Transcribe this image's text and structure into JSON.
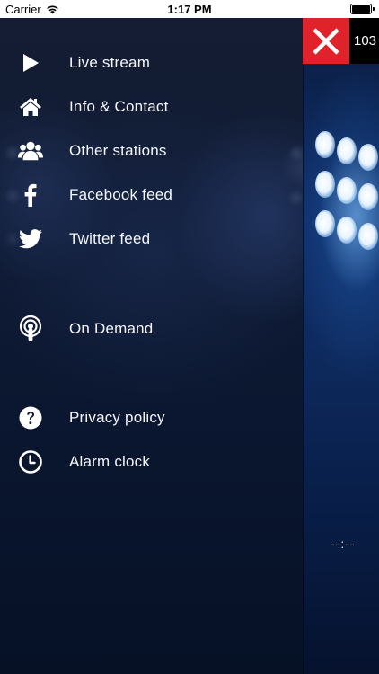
{
  "status_bar": {
    "carrier": "Carrier",
    "time": "1:17 PM"
  },
  "menu": {
    "items": [
      {
        "label": "Live stream",
        "icon": "play-icon"
      },
      {
        "label": "Info & Contact",
        "icon": "home-icon"
      },
      {
        "label": "Other stations",
        "icon": "users-icon"
      },
      {
        "label": "Facebook feed",
        "icon": "facebook-icon"
      },
      {
        "label": "Twitter feed",
        "icon": "twitter-icon"
      },
      {
        "label": "On Demand",
        "icon": "podcast-icon"
      },
      {
        "label": "Privacy policy",
        "icon": "question-circle-icon"
      },
      {
        "label": "Alarm clock",
        "icon": "clock-icon"
      }
    ]
  },
  "player": {
    "frequency": "103",
    "time_readout": "--:--"
  },
  "colors": {
    "close_button": "#e0232a",
    "drawer_background": "#0f1a33",
    "menu_text": "#ffffff"
  }
}
